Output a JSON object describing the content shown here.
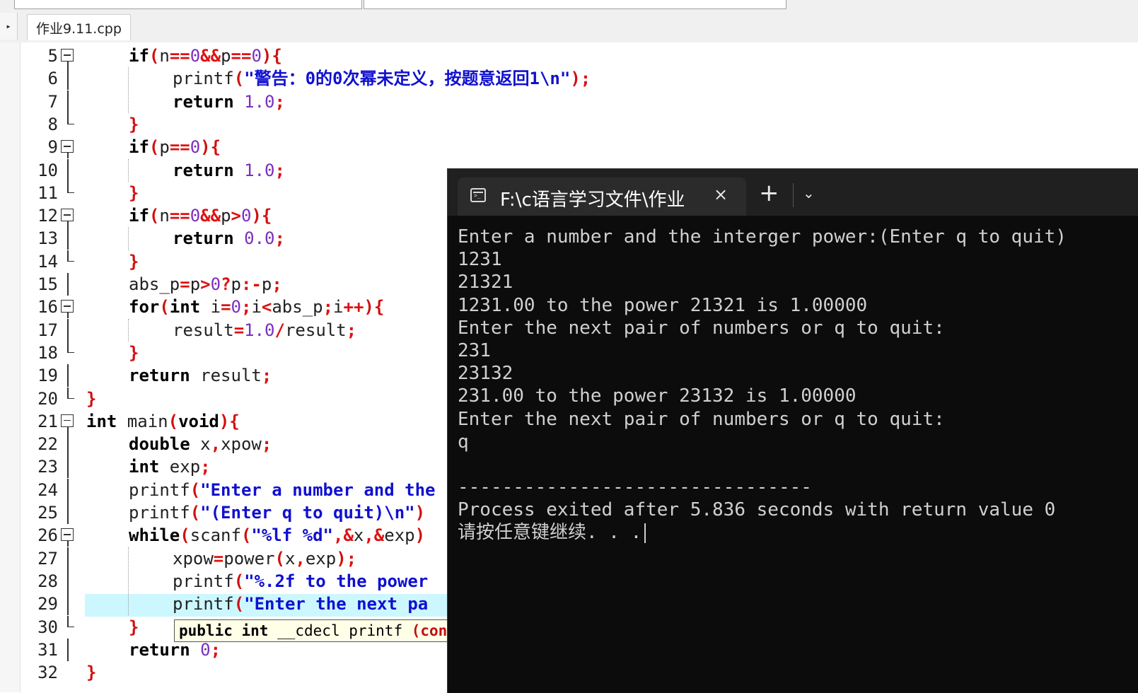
{
  "editor": {
    "tab_label": "作业9.11.cpp",
    "tab_arrow": "▸",
    "lines": [
      {
        "n": "5",
        "segs": [
          [
            "kw",
            "if"
          ],
          [
            "br",
            "("
          ],
          [
            "id",
            "n"
          ],
          [
            "op",
            "=="
          ],
          [
            "num",
            "0"
          ],
          [
            "op",
            "&&"
          ],
          [
            "id",
            "p"
          ],
          [
            "op",
            "=="
          ],
          [
            "num",
            "0"
          ],
          [
            "br",
            "){"
          ]
        ]
      },
      {
        "n": "6",
        "segs": [
          [
            "id",
            "printf"
          ],
          [
            "br",
            "("
          ],
          [
            "str",
            "\"警告：0的0次幂未定义，按题意返回1\\n\""
          ],
          [
            "br",
            ")"
          ],
          [
            "op",
            ";"
          ]
        ]
      },
      {
        "n": "7",
        "segs": [
          [
            "kw",
            "return"
          ],
          [
            "id",
            " "
          ],
          [
            "num",
            "1.0"
          ],
          [
            "op",
            ";"
          ]
        ]
      },
      {
        "n": "8",
        "segs": [
          [
            "br",
            "}"
          ]
        ]
      },
      {
        "n": "9",
        "segs": [
          [
            "kw",
            "if"
          ],
          [
            "br",
            "("
          ],
          [
            "id",
            "p"
          ],
          [
            "op",
            "=="
          ],
          [
            "num",
            "0"
          ],
          [
            "br",
            "){"
          ]
        ]
      },
      {
        "n": "10",
        "segs": [
          [
            "kw",
            "return"
          ],
          [
            "id",
            " "
          ],
          [
            "num",
            "1.0"
          ],
          [
            "op",
            ";"
          ]
        ]
      },
      {
        "n": "11",
        "segs": [
          [
            "br",
            "}"
          ]
        ]
      },
      {
        "n": "12",
        "segs": [
          [
            "kw",
            "if"
          ],
          [
            "br",
            "("
          ],
          [
            "id",
            "n"
          ],
          [
            "op",
            "=="
          ],
          [
            "num",
            "0"
          ],
          [
            "op",
            "&&"
          ],
          [
            "id",
            "p"
          ],
          [
            "op",
            ">"
          ],
          [
            "num",
            "0"
          ],
          [
            "br",
            "){"
          ]
        ]
      },
      {
        "n": "13",
        "segs": [
          [
            "kw",
            "return"
          ],
          [
            "id",
            " "
          ],
          [
            "num",
            "0.0"
          ],
          [
            "op",
            ";"
          ]
        ]
      },
      {
        "n": "14",
        "segs": [
          [
            "br",
            "}"
          ]
        ]
      },
      {
        "n": "15",
        "segs": [
          [
            "id",
            "abs_p"
          ],
          [
            "op",
            "="
          ],
          [
            "id",
            "p"
          ],
          [
            "op",
            ">"
          ],
          [
            "num",
            "0"
          ],
          [
            "op",
            "?"
          ],
          [
            "id",
            "p"
          ],
          [
            "op",
            ":-"
          ],
          [
            "id",
            "p"
          ],
          [
            "op",
            ";"
          ]
        ]
      },
      {
        "n": "16",
        "segs": [
          [
            "kw",
            "for"
          ],
          [
            "br",
            "("
          ],
          [
            "kw",
            "int"
          ],
          [
            "id",
            " i"
          ],
          [
            "op",
            "="
          ],
          [
            "num",
            "0"
          ],
          [
            "op",
            ";"
          ],
          [
            "id",
            "i"
          ],
          [
            "op",
            "<"
          ],
          [
            "id",
            "abs_p"
          ],
          [
            "op",
            ";"
          ],
          [
            "id",
            "i"
          ],
          [
            "op",
            "++"
          ],
          [
            "br",
            "){"
          ]
        ]
      },
      {
        "n": "17",
        "segs": [
          [
            "id",
            "result"
          ],
          [
            "op",
            "="
          ],
          [
            "num",
            "1.0"
          ],
          [
            "op",
            "/"
          ],
          [
            "id",
            "result"
          ],
          [
            "op",
            ";"
          ]
        ]
      },
      {
        "n": "18",
        "segs": [
          [
            "br",
            "}"
          ]
        ]
      },
      {
        "n": "19",
        "segs": [
          [
            "kw",
            "return"
          ],
          [
            "id",
            " result"
          ],
          [
            "op",
            ";"
          ]
        ]
      },
      {
        "n": "20",
        "segs": [
          [
            "br",
            "}"
          ]
        ]
      },
      {
        "n": "21",
        "segs": [
          [
            "kw",
            "int"
          ],
          [
            "id",
            " main"
          ],
          [
            "br",
            "("
          ],
          [
            "kw",
            "void"
          ],
          [
            "br",
            "){"
          ]
        ]
      },
      {
        "n": "22",
        "segs": [
          [
            "kw",
            "double"
          ],
          [
            "id",
            " x"
          ],
          [
            "op",
            ","
          ],
          [
            "id",
            "xpow"
          ],
          [
            "op",
            ";"
          ]
        ]
      },
      {
        "n": "23",
        "segs": [
          [
            "kw",
            "int"
          ],
          [
            "id",
            " exp"
          ],
          [
            "op",
            ";"
          ]
        ]
      },
      {
        "n": "24",
        "segs": [
          [
            "id",
            "printf"
          ],
          [
            "br",
            "("
          ],
          [
            "str",
            "\"Enter a number and the"
          ]
        ]
      },
      {
        "n": "25",
        "segs": [
          [
            "id",
            "printf"
          ],
          [
            "br",
            "("
          ],
          [
            "str",
            "\"(Enter q to quit)\\n\""
          ],
          [
            "br",
            ")"
          ]
        ]
      },
      {
        "n": "26",
        "segs": [
          [
            "kw",
            "while"
          ],
          [
            "br",
            "("
          ],
          [
            "id",
            "scanf"
          ],
          [
            "br",
            "("
          ],
          [
            "str",
            "\"%lf %d\""
          ],
          [
            "op",
            ",&"
          ],
          [
            "id",
            "x"
          ],
          [
            "op",
            ",&"
          ],
          [
            "id",
            "exp"
          ],
          [
            "br",
            ")"
          ]
        ]
      },
      {
        "n": "27",
        "segs": [
          [
            "id",
            "xpow"
          ],
          [
            "op",
            "="
          ],
          [
            "id",
            "power"
          ],
          [
            "br",
            "("
          ],
          [
            "id",
            "x"
          ],
          [
            "op",
            ","
          ],
          [
            "id",
            "exp"
          ],
          [
            "br",
            ")"
          ],
          [
            "op",
            ";"
          ]
        ]
      },
      {
        "n": "28",
        "segs": [
          [
            "id",
            "printf"
          ],
          [
            "br",
            "("
          ],
          [
            "str",
            "\"%.2f to the power"
          ]
        ]
      },
      {
        "n": "29",
        "segs": [
          [
            "id",
            "printf"
          ],
          [
            "br",
            "("
          ],
          [
            "str",
            "\"Enter the next pa"
          ]
        ]
      },
      {
        "n": "30",
        "segs": [
          [
            "br",
            "}"
          ]
        ]
      },
      {
        "n": "31",
        "segs": [
          [
            "kw",
            "return"
          ],
          [
            "id",
            " "
          ],
          [
            "num",
            "0"
          ],
          [
            "op",
            ";"
          ]
        ]
      },
      {
        "n": "32",
        "segs": [
          [
            "br",
            "}"
          ]
        ]
      }
    ],
    "tooltip": {
      "kw": "public int",
      "mid": " __cdecl printf ",
      "tail": "(const"
    }
  },
  "terminal": {
    "tab_title": "F:\\c语言学习文件\\作业",
    "close_glyph": "×",
    "new_tab_glyph": "+",
    "dropdown_glyph": "⌄",
    "lines": [
      "Enter a number and the interger power:(Enter q to quit)",
      "1231",
      "21321",
      "1231.00 to the power 21321 is 1.00000",
      "Enter the next pair of numbers or q to quit:",
      "231",
      "23132",
      "231.00 to the power 23132 is 1.00000",
      "Enter the next pair of numbers or q to quit:",
      "q",
      "",
      "--------------------------------",
      "Process exited after 5.836 seconds with return value 0",
      "请按任意键继续. . ."
    ]
  }
}
